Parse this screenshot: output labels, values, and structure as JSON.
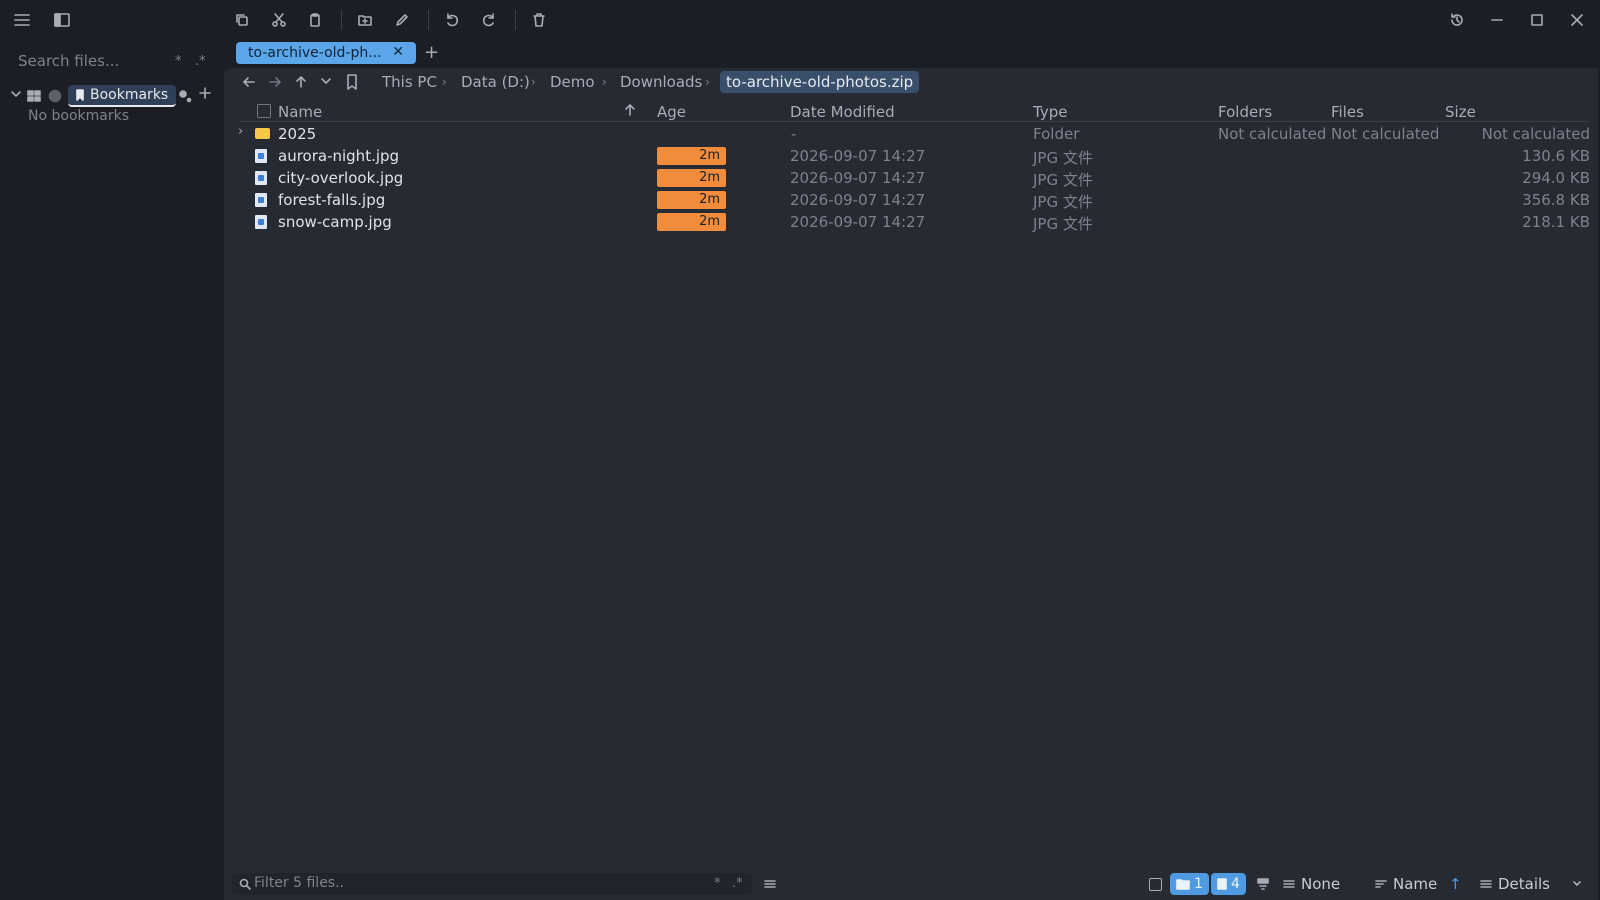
{
  "sidebar": {
    "search_placeholder": "Search files...",
    "search_star": "*",
    "search_regex": ".*",
    "bookmarks_label": "Bookmarks",
    "no_bookmarks": "No bookmarks"
  },
  "tabs": [
    {
      "label": "to-archive-old-ph...",
      "close": "✕"
    }
  ],
  "tab_add": "+",
  "breadcrumb": [
    "This PC",
    "Data (D:)",
    "Demo",
    "Downloads"
  ],
  "breadcrumb_active": "to-archive-old-photos.zip",
  "columns": {
    "name": "Name",
    "age": "Age",
    "date": "Date Modified",
    "type": "Type",
    "folders": "Folders",
    "files": "Files",
    "size": "Size"
  },
  "rows": [
    {
      "name": "2025",
      "age": "",
      "date": "-",
      "type": "Folder",
      "folders": "Not calculated",
      "files": "Not calculated",
      "size": "Not calculated",
      "kind": "folder"
    },
    {
      "name": "aurora-night.jpg",
      "age": "2m",
      "date": "2026-09-07 14:27",
      "type": "JPG 文件",
      "folders": "",
      "files": "",
      "size": "130.6 KB",
      "kind": "file"
    },
    {
      "name": "city-overlook.jpg",
      "age": "2m",
      "date": "2026-09-07 14:27",
      "type": "JPG 文件",
      "folders": "",
      "files": "",
      "size": "294.0 KB",
      "kind": "file"
    },
    {
      "name": "forest-falls.jpg",
      "age": "2m",
      "date": "2026-09-07 14:27",
      "type": "JPG 文件",
      "folders": "",
      "files": "",
      "size": "356.8 KB",
      "kind": "file"
    },
    {
      "name": "snow-camp.jpg",
      "age": "2m",
      "date": "2026-09-07 14:27",
      "type": "JPG 文件",
      "folders": "",
      "files": "",
      "size": "218.1 KB",
      "kind": "file"
    }
  ],
  "footer": {
    "filter_placeholder": "Filter 5 files..",
    "filter_star": "*",
    "filter_regex": ".*",
    "folder_count": "1",
    "file_count": "4",
    "group_label": "None",
    "sort_label": "Name",
    "sort_dir": "↑",
    "view_label": "Details"
  },
  "colors": {
    "accent": "#5aa6e8",
    "age_badge": "#f08c3c",
    "background": "#1b1e24",
    "panel": "#262a33"
  }
}
